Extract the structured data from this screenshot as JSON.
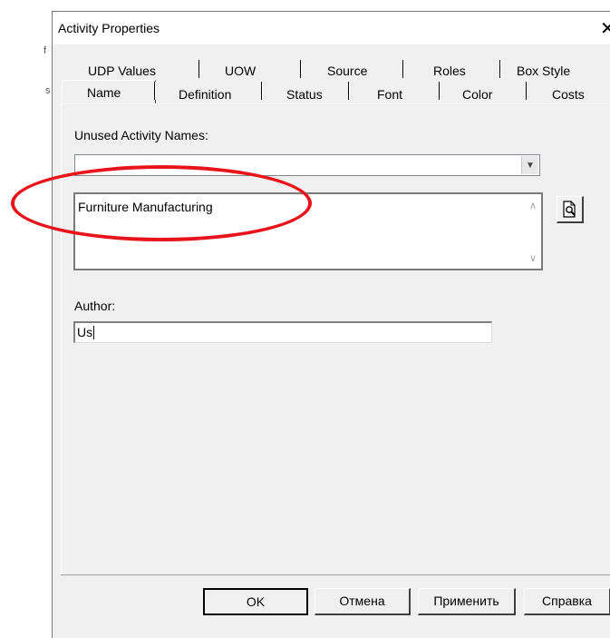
{
  "window": {
    "title": "Activity Properties",
    "close": "✕"
  },
  "tabs": {
    "row1": [
      "UDP Values",
      "UOW",
      "Source",
      "Roles",
      "Box Style"
    ],
    "row2": [
      "Name",
      "Definition",
      "Status",
      "Font",
      "Color",
      "Costs"
    ],
    "active": "Name"
  },
  "form": {
    "unused_label": "Unused Activity Names:",
    "unused_value": "",
    "name_value": "Furniture Manufacturing",
    "author_label": "Author:",
    "author_value": "Us"
  },
  "buttons": {
    "ok": "OK",
    "cancel": "Отмена",
    "apply": "Применить",
    "help": "Справка"
  },
  "annotation_color": "#e8141b"
}
